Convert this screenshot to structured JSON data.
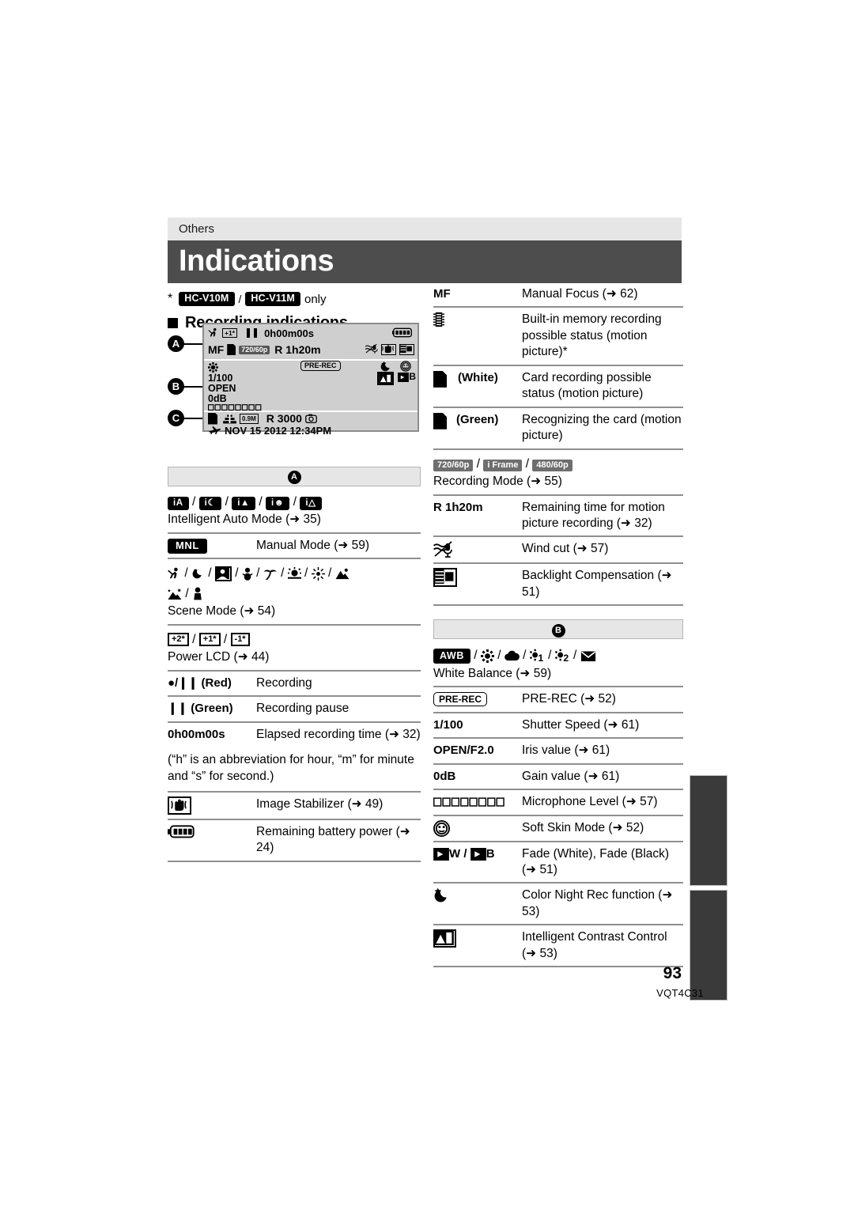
{
  "page": {
    "kicker": "Others",
    "title": "Indications",
    "footnote_star": "*",
    "footnote_model_1": "HC-V10M",
    "footnote_sep": "/",
    "footnote_model_2": "HC-V11M",
    "footnote_suffix": "only",
    "section_heading": "Recording indications",
    "page_number": "93",
    "doc_id": "VQT4C31"
  },
  "lcd": {
    "label_a": "A",
    "label_b": "B",
    "label_c": "C",
    "band_a": {
      "elapsed_time": "0h00m00s",
      "mf": "MF",
      "rec_mode_tag": "720/60p",
      "remaining": "R 1h20m"
    },
    "band_b": {
      "shutter": "1/100",
      "iris": "OPEN",
      "gain": "0dB",
      "prerec": "PRE-REC",
      "fade_b": "B"
    },
    "band_c": {
      "pixels_tag": "0.9M",
      "remaining_photos": "R 3000",
      "datetime": "NOV 15 2012 12:34PM"
    }
  },
  "section_a": {
    "header": "A",
    "rows": [
      {
        "type": "icons_caption",
        "icons": [
          "iA",
          "iA-lowlight",
          "iA-scenery",
          "iA-portrait",
          "iA-spotlight"
        ],
        "caption": "Intelligent Auto Mode (➜ 35)"
      },
      {
        "type": "key_value",
        "key": "MNL",
        "key_style": "chip",
        "value": "Manual Mode (➜ 59)"
      },
      {
        "type": "icons_caption",
        "icons": [
          "sports",
          "portrait",
          "soft-skin",
          "spotlight",
          "snow",
          "beach",
          "sunset",
          "scenery",
          "fireworks",
          "night-scenery",
          "night-portrait"
        ],
        "caption": "Scene Mode (➜ 54)"
      },
      {
        "type": "icons_caption",
        "icons": [
          "power-lcd-plus2",
          "power-lcd-plus1",
          "power-lcd-minus1"
        ],
        "caption": "Power LCD (➜ 44)"
      },
      {
        "type": "key_value",
        "key": "●/❙❙ (Red)",
        "value": "Recording"
      },
      {
        "type": "key_value",
        "key": "❙❙ (Green)",
        "value": "Recording pause"
      },
      {
        "type": "key_value",
        "key": "0h00m00s",
        "value": "Elapsed recording time (➜ 32)"
      },
      {
        "type": "paragraph",
        "text": "(“h” is an abbreviation for hour, “m” for minute and “s” for second.)"
      },
      {
        "type": "icon_value",
        "icon": "image-stabilizer-icon",
        "value": "Image Stabilizer (➜ 49)"
      },
      {
        "type": "icon_value",
        "icon": "battery-icon",
        "value": "Remaining battery power (➜ 24)"
      }
    ]
  },
  "right_top": {
    "rows": [
      {
        "type": "key_value",
        "key": "MF",
        "value": "Manual Focus (➜ 62)"
      },
      {
        "type": "icon_value",
        "icon": "built-in-memory-icon",
        "value": "Built-in memory recording possible status (motion picture)*"
      },
      {
        "type": "icon_key_value",
        "icon": "card-white-icon",
        "key": "(White)",
        "value": "Card recording possible status (motion picture)"
      },
      {
        "type": "icon_key_value",
        "icon": "card-green-icon",
        "key": "(Green)",
        "value": "Recognizing the card (motion picture)"
      },
      {
        "type": "tags_caption",
        "tags": [
          "720/60p",
          "i Frame",
          "480/60p"
        ],
        "caption": "Recording Mode (➜ 55)"
      },
      {
        "type": "key_value",
        "key": "R 1h20m",
        "value": "Remaining time for motion picture recording (➜ 32)"
      },
      {
        "type": "icon_value",
        "icon": "wind-cut-icon",
        "value": "Wind cut (➜ 57)"
      },
      {
        "type": "icon_value",
        "icon": "backlight-compensation-icon",
        "value": "Backlight Compensation (➜ 51)"
      }
    ]
  },
  "section_b": {
    "header": "B",
    "rows": [
      {
        "type": "icons_caption",
        "icons": [
          "AWB",
          "sunny",
          "cloudy",
          "indoor1",
          "indoor2",
          "manual-wb"
        ],
        "caption": "White Balance (➜ 59)"
      },
      {
        "type": "key_value",
        "key": "PRE-REC",
        "key_style": "outline",
        "value": "PRE-REC (➜ 52)"
      },
      {
        "type": "key_value",
        "key": "1/100",
        "value": "Shutter Speed (➜ 61)"
      },
      {
        "type": "key_value",
        "key": "OPEN/F2.0",
        "value": "Iris value (➜ 61)"
      },
      {
        "type": "key_value",
        "key": "0dB",
        "value": "Gain value (➜ 61)"
      },
      {
        "type": "icon_value",
        "icon": "microphone-level-icon",
        "value": "Microphone Level (➜ 57)"
      },
      {
        "type": "icon_value",
        "icon": "soft-skin-icon",
        "value": "Soft Skin Mode (➜ 52)"
      },
      {
        "type": "icon_value",
        "icon": "fade-icon",
        "key_w": "W",
        "key_b": "B",
        "value": "Fade (White), Fade (Black) (➜ 51)"
      },
      {
        "type": "icon_value",
        "icon": "color-night-rec-icon",
        "value": "Color Night Rec function (➜ 53)"
      },
      {
        "type": "icon_value",
        "icon": "intelligent-contrast-icon",
        "value": "Intelligent Contrast Control (➜ 53)"
      }
    ]
  }
}
